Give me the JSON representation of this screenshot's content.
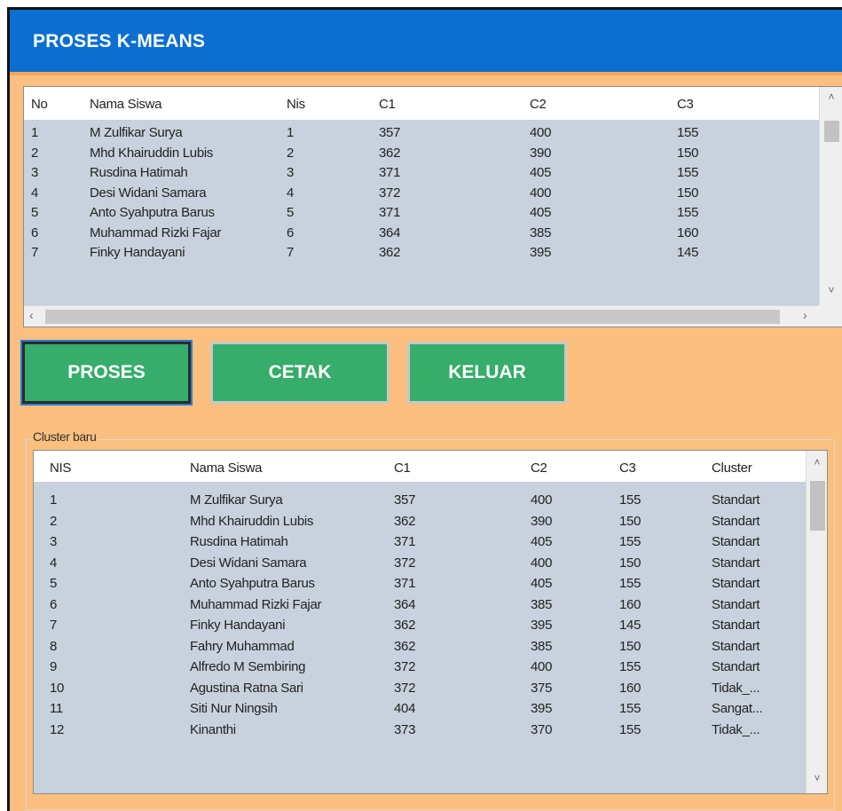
{
  "window": {
    "title": "PROSES K-MEANS"
  },
  "colors": {
    "title_bar": "#0a6fd0",
    "form_bg": "#fbbf7f",
    "button": "#36ad6a",
    "grid_row": "#c8d2de"
  },
  "top_grid": {
    "columns": [
      "No",
      "Nama Siswa",
      "Nis",
      "C1",
      "C2",
      "C3"
    ],
    "rows": [
      [
        "1",
        "M Zulfikar Surya",
        "1",
        "357",
        "400",
        "155"
      ],
      [
        "2",
        "Mhd Khairuddin Lubis",
        "2",
        "362",
        "390",
        "150"
      ],
      [
        "3",
        "Rusdina Hatimah",
        "3",
        "371",
        "405",
        "155"
      ],
      [
        "4",
        "Desi Widani Samara",
        "4",
        "372",
        "400",
        "150"
      ],
      [
        "5",
        "Anto Syahputra Barus",
        "5",
        "371",
        "405",
        "155"
      ],
      [
        "6",
        "Muhammad Rizki Fajar",
        "6",
        "364",
        "385",
        "160"
      ],
      [
        "7",
        "Finky Handayani",
        "7",
        "362",
        "395",
        "145"
      ]
    ],
    "scroll_up_icon": "chevron-up-icon",
    "scroll_down_icon": "chevron-down-icon"
  },
  "buttons": {
    "proses": "PROSES",
    "cetak": "CETAK",
    "keluar": "KELUAR"
  },
  "cluster_group": {
    "label": "Cluster baru",
    "columns": [
      "NIS",
      "Nama Siswa",
      "C1",
      "C2",
      "C3",
      "Cluster"
    ],
    "rows": [
      [
        "1",
        "M Zulfikar Surya",
        "357",
        "400",
        "155",
        "Standart"
      ],
      [
        "2",
        "Mhd Khairuddin Lubis",
        "362",
        "390",
        "150",
        "Standart"
      ],
      [
        "3",
        "Rusdina Hatimah",
        "371",
        "405",
        "155",
        "Standart"
      ],
      [
        "4",
        "Desi Widani Samara",
        "372",
        "400",
        "150",
        "Standart"
      ],
      [
        "5",
        "Anto Syahputra Barus",
        "371",
        "405",
        "155",
        "Standart"
      ],
      [
        "6",
        "Muhammad Rizki Fajar",
        "364",
        "385",
        "160",
        "Standart"
      ],
      [
        "7",
        "Finky Handayani",
        "362",
        "395",
        "145",
        "Standart"
      ],
      [
        "8",
        "Fahry Muhammad",
        "362",
        "385",
        "150",
        "Standart"
      ],
      [
        "9",
        "Alfredo M Sembiring",
        "372",
        "400",
        "155",
        "Standart"
      ],
      [
        "10",
        "Agustina Ratna Sari",
        "372",
        "375",
        "160",
        "Tidak_..."
      ],
      [
        "11",
        "Siti Nur Ningsih",
        "404",
        "395",
        "155",
        "Sangat..."
      ],
      [
        "12",
        "Kinanthi",
        "373",
        "370",
        "155",
        "Tidak_..."
      ]
    ]
  }
}
